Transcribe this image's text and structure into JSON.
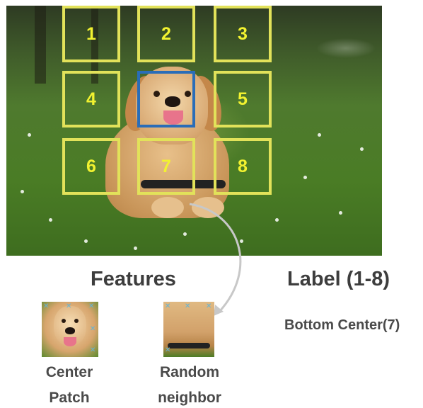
{
  "grid": {
    "cells": [
      "1",
      "2",
      "3",
      "4",
      "",
      "5",
      "6",
      "7",
      "8"
    ]
  },
  "features_heading": "Features",
  "label_heading": "Label (1-8)",
  "label_value": "Bottom Center(7)",
  "captions": {
    "center_line1": "Center",
    "center_line2": "Patch",
    "random_line1": "Random",
    "random_line2": "neighbor"
  },
  "colors": {
    "grid_yellow": "#e2e25a",
    "center_blue": "#2a6db8",
    "arrow_gray": "#c8c8c8"
  }
}
